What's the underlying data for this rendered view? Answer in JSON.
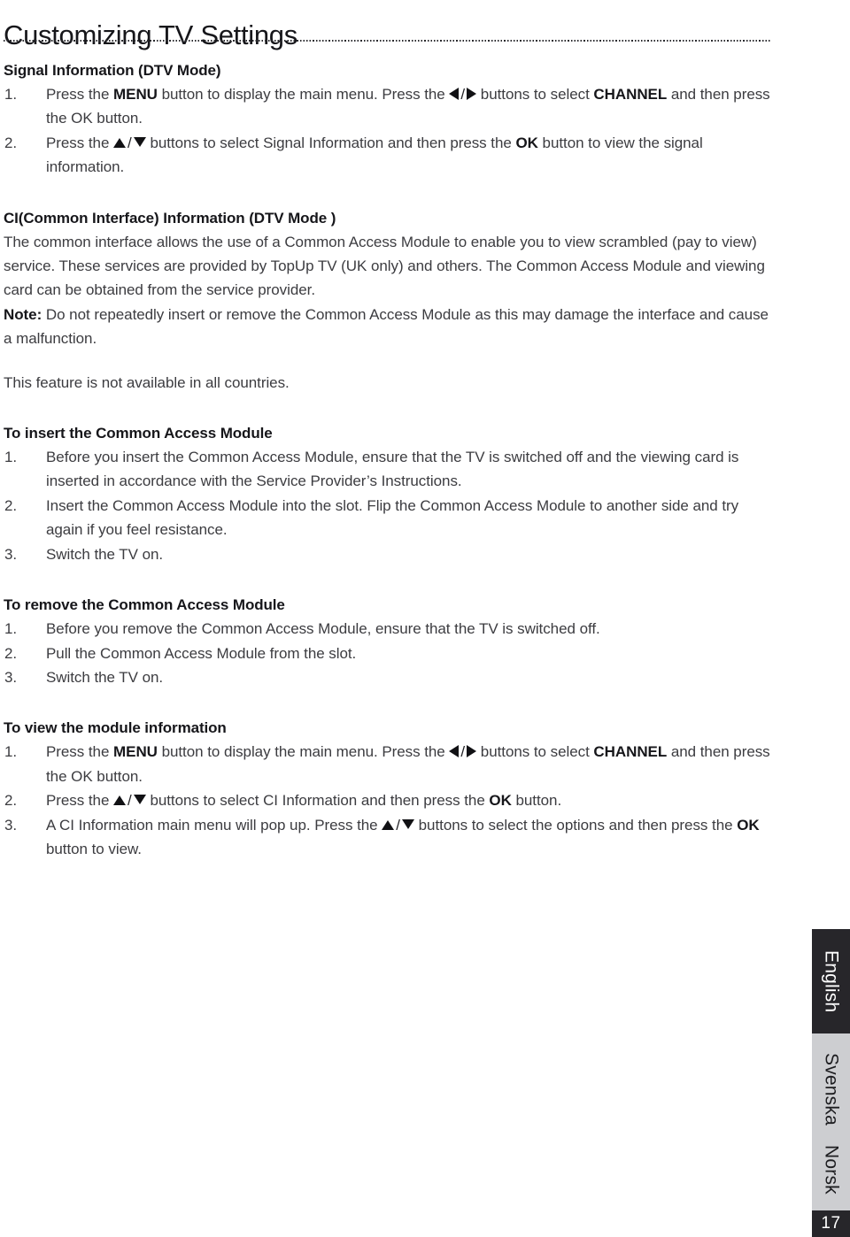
{
  "document": {
    "title": "Customizing TV Settings",
    "page_number": "17"
  },
  "sections": {
    "signal_information": {
      "heading": "Signal Information (DTV Mode)",
      "steps": [
        {
          "num": "1.",
          "parts": [
            {
              "t": "Press the ",
              "b": false
            },
            {
              "t": "MENU",
              "b": true
            },
            {
              "t": " button to display the main menu. Press the ",
              "b": false
            },
            {
              "t": "ARROWS_LR",
              "b": false
            },
            {
              "t": " buttons to select ",
              "b": false
            },
            {
              "t": "CHANNEL",
              "b": true
            },
            {
              "t": " and then press the OK button.",
              "b": false
            }
          ]
        },
        {
          "num": "2.",
          "parts": [
            {
              "t": "Press the ",
              "b": false
            },
            {
              "t": "ARROWS_UD",
              "b": false
            },
            {
              "t": " buttons to select Signal Information and then press the ",
              "b": false
            },
            {
              "t": "OK",
              "b": true
            },
            {
              "t": " button to view the signal information.",
              "b": false
            }
          ]
        }
      ]
    },
    "ci_information": {
      "heading": "CI(Common Interface) Information (DTV Mode )",
      "paragraph_lines": [
        "The common interface allows the use of a Common Access Module to enable you to view scrambled (pay to view) service. These services are provided by TopUp TV (UK only) and others. The Common Access Module and viewing card can be obtained from the service provider."
      ],
      "note_label": "Note:",
      "note_text": " Do not repeatedly insert or remove the Common Access Module as this may damage the interface and cause a malfunction.",
      "availability": "This feature is not available in all countries."
    },
    "insert_module": {
      "heading": "To insert the Common Access Module",
      "steps": [
        {
          "num": "1.",
          "parts": [
            {
              "t": "Before you insert the Common Access Module, ensure that the TV is switched off and the viewing card is inserted in accordance with the Service Provider’s Instructions.",
              "b": false
            }
          ]
        },
        {
          "num": "2.",
          "parts": [
            {
              "t": "Insert the Common Access Module into the slot. Flip the Common Access Module to another side and try again if you feel resistance.",
              "b": false
            }
          ]
        },
        {
          "num": "3.",
          "parts": [
            {
              "t": "Switch the TV on.",
              "b": false
            }
          ]
        }
      ]
    },
    "remove_module": {
      "heading": "To remove the Common Access Module",
      "steps": [
        {
          "num": "1.",
          "parts": [
            {
              "t": "Before you remove the Common Access Module, ensure that the TV is switched off.",
              "b": false
            }
          ]
        },
        {
          "num": "2.",
          "parts": [
            {
              "t": "Pull the Common Access Module from the slot.",
              "b": false
            }
          ]
        },
        {
          "num": "3.",
          "parts": [
            {
              "t": "Switch the TV on.",
              "b": false
            }
          ]
        }
      ]
    },
    "view_module_information": {
      "heading": "To view the module information",
      "steps": [
        {
          "num": "1.",
          "parts": [
            {
              "t": "Press the ",
              "b": false
            },
            {
              "t": "MENU",
              "b": true
            },
            {
              "t": " button to display the main menu. Press the ",
              "b": false
            },
            {
              "t": "ARROWS_LR",
              "b": false
            },
            {
              "t": " buttons to select ",
              "b": false
            },
            {
              "t": "CHANNEL",
              "b": true
            },
            {
              "t": " and then press the OK button.",
              "b": false
            }
          ]
        },
        {
          "num": "2.",
          "parts": [
            {
              "t": "Press the ",
              "b": false
            },
            {
              "t": "ARROWS_UD",
              "b": false
            },
            {
              "t": " buttons to select CI Information and then press the ",
              "b": false
            },
            {
              "t": "OK",
              "b": true
            },
            {
              "t": " button.",
              "b": false
            }
          ]
        },
        {
          "num": "3.",
          "parts": [
            {
              "t": "A CI Information main menu will pop up. Press the ",
              "b": false
            },
            {
              "t": "ARROWS_UD",
              "b": false
            },
            {
              "t": " buttons to select the options and then press the ",
              "b": false
            },
            {
              "t": "OK",
              "b": true
            },
            {
              "t": " button to view.",
              "b": false
            }
          ]
        }
      ]
    }
  },
  "sidebar": {
    "languages": [
      {
        "label": "English",
        "active": true
      },
      {
        "label": "Svenska",
        "active": false
      },
      {
        "label": "Norsk",
        "active": false
      }
    ]
  },
  "colors": {
    "tab_active_bg": "#27262a",
    "tab_inactive_bg": "#cdced1",
    "body_text": "#3c3c40",
    "heading_text": "#16161a"
  }
}
